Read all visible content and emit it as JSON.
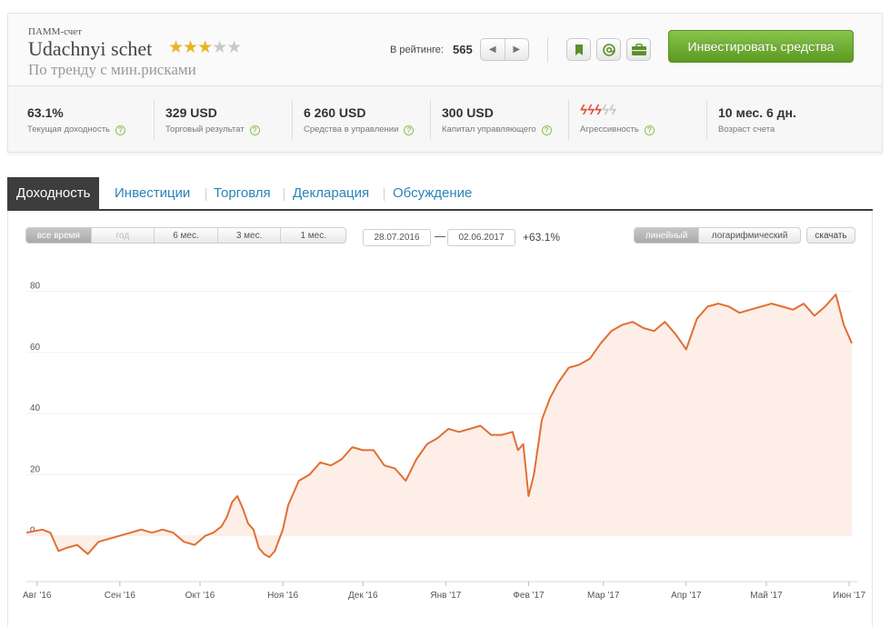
{
  "account": {
    "type_label": "ПАММ-счет",
    "name": "Udachnyi schet",
    "stars_on": "★★★",
    "stars_off": "★★",
    "rating_stars": 3,
    "rating_max": 5,
    "subtitle": "По тренду с мин.рисками"
  },
  "rating": {
    "label": "В рейтинге:",
    "value": "565",
    "prev_icon": "chevron-left-icon",
    "next_icon": "chevron-right-icon"
  },
  "actions": {
    "icons": [
      "bookmark-icon",
      "email-icon",
      "briefcase-icon"
    ],
    "invest_label": "Инвестировать средства",
    "invest_color": "#6fae34"
  },
  "stats": [
    {
      "value": "63.1%",
      "label": "Текущая доходность"
    },
    {
      "value": "329 USD",
      "label": "Торговый результат"
    },
    {
      "value": "6 260 USD",
      "label": "Средства в управлении"
    },
    {
      "value": "300 USD",
      "label": "Капитал управляющего"
    },
    {
      "value": "",
      "label": "Агрессивность",
      "level": 3,
      "max": 5
    },
    {
      "value": "10 мес. 6 дн.",
      "label": "Возраст счета"
    }
  ],
  "help_glyph": "?",
  "tabs": [
    "Доходность",
    "Инвестиции",
    "Торговля",
    "Декларация",
    "Обсуждение"
  ],
  "active_tab": 0,
  "periods": [
    "все время",
    "год",
    "6 мес.",
    "3 мес.",
    "1 мес."
  ],
  "active_period": 0,
  "disabled_period": 1,
  "date_from": "28.07.2016",
  "date_to": "02.06.2017",
  "period_change": "+63.1%",
  "scale_options": [
    "линейный",
    "логарифмический"
  ],
  "active_scale": 0,
  "download_label": "скачать",
  "colors": {
    "line": "#e06f34",
    "fill": "#fdeee8",
    "link": "#2b83b8",
    "aggr_on": "#e0533a",
    "aggr_off": "#c8c8c8"
  },
  "chart_data": {
    "type": "area",
    "title": "",
    "xlabel": "",
    "ylabel": "",
    "ylim": [
      -15,
      90
    ],
    "yticks": [
      0,
      20,
      40,
      60,
      80
    ],
    "xlim": [
      "2016-07-28",
      "2017-06-02"
    ],
    "xticks": [
      {
        "date": "2016-08-01",
        "label": "Авг '16"
      },
      {
        "date": "2016-09-01",
        "label": "Сен '16"
      },
      {
        "date": "2016-10-01",
        "label": "Окт '16"
      },
      {
        "date": "2016-11-01",
        "label": "Ноя '16"
      },
      {
        "date": "2016-12-01",
        "label": "Дек '16"
      },
      {
        "date": "2017-01-01",
        "label": "Янв '17"
      },
      {
        "date": "2017-02-01",
        "label": "Фев '17"
      },
      {
        "date": "2017-03-01",
        "label": "Мар '17"
      },
      {
        "date": "2017-04-01",
        "label": "Апр '17"
      },
      {
        "date": "2017-05-01",
        "label": "Май '17"
      },
      {
        "date": "2017-06-01",
        "label": "Июн '17"
      }
    ],
    "grid": true,
    "legend": "none",
    "series": [
      {
        "x": [
          "2016-07-28",
          "2016-08-03",
          "2016-08-06",
          "2016-08-09",
          "2016-08-12",
          "2016-08-16",
          "2016-08-20",
          "2016-08-24",
          "2016-08-28",
          "2016-09-01",
          "2016-09-05",
          "2016-09-09",
          "2016-09-13",
          "2016-09-17",
          "2016-09-21",
          "2016-09-25",
          "2016-09-29",
          "2016-10-03",
          "2016-10-06",
          "2016-10-09",
          "2016-10-11",
          "2016-10-13",
          "2016-10-15",
          "2016-10-17",
          "2016-10-19",
          "2016-10-21",
          "2016-10-23",
          "2016-10-25",
          "2016-10-27",
          "2016-10-29",
          "2016-11-01",
          "2016-11-03",
          "2016-11-07",
          "2016-11-11",
          "2016-11-15",
          "2016-11-19",
          "2016-11-23",
          "2016-11-27",
          "2016-12-01",
          "2016-12-05",
          "2016-12-09",
          "2016-12-13",
          "2016-12-17",
          "2016-12-21",
          "2016-12-25",
          "2016-12-29",
          "2017-01-02",
          "2017-01-06",
          "2017-01-10",
          "2017-01-14",
          "2017-01-18",
          "2017-01-22",
          "2017-01-26",
          "2017-01-28",
          "2017-01-30",
          "2017-02-01",
          "2017-02-03",
          "2017-02-06",
          "2017-02-09",
          "2017-02-12",
          "2017-02-16",
          "2017-02-20",
          "2017-02-24",
          "2017-02-28",
          "2017-03-04",
          "2017-03-08",
          "2017-03-12",
          "2017-03-16",
          "2017-03-20",
          "2017-03-24",
          "2017-03-28",
          "2017-04-01",
          "2017-04-05",
          "2017-04-09",
          "2017-04-13",
          "2017-04-17",
          "2017-04-21",
          "2017-04-25",
          "2017-04-29",
          "2017-05-03",
          "2017-05-07",
          "2017-05-11",
          "2017-05-15",
          "2017-05-19",
          "2017-05-23",
          "2017-05-27",
          "2017-05-30",
          "2017-06-02"
        ],
        "y": [
          1,
          2,
          1,
          -5,
          -4,
          -3,
          -6,
          -2,
          -1,
          0,
          1,
          2,
          1,
          2,
          1,
          -2,
          -3,
          0,
          1,
          3,
          6,
          11,
          13,
          9,
          4,
          2,
          -4,
          -6,
          -7,
          -5,
          2,
          10,
          18,
          20,
          24,
          23,
          25,
          29,
          28,
          28,
          23,
          22,
          18,
          25,
          30,
          32,
          35,
          34,
          35,
          36,
          33,
          33,
          34,
          28,
          30,
          13,
          20,
          38,
          45,
          50,
          55,
          56,
          58,
          63,
          67,
          69,
          70,
          68,
          67,
          70,
          66,
          61,
          71,
          75,
          76,
          75,
          73,
          74,
          75,
          76,
          75,
          74,
          76,
          72,
          75,
          79,
          69,
          63
        ]
      }
    ]
  }
}
